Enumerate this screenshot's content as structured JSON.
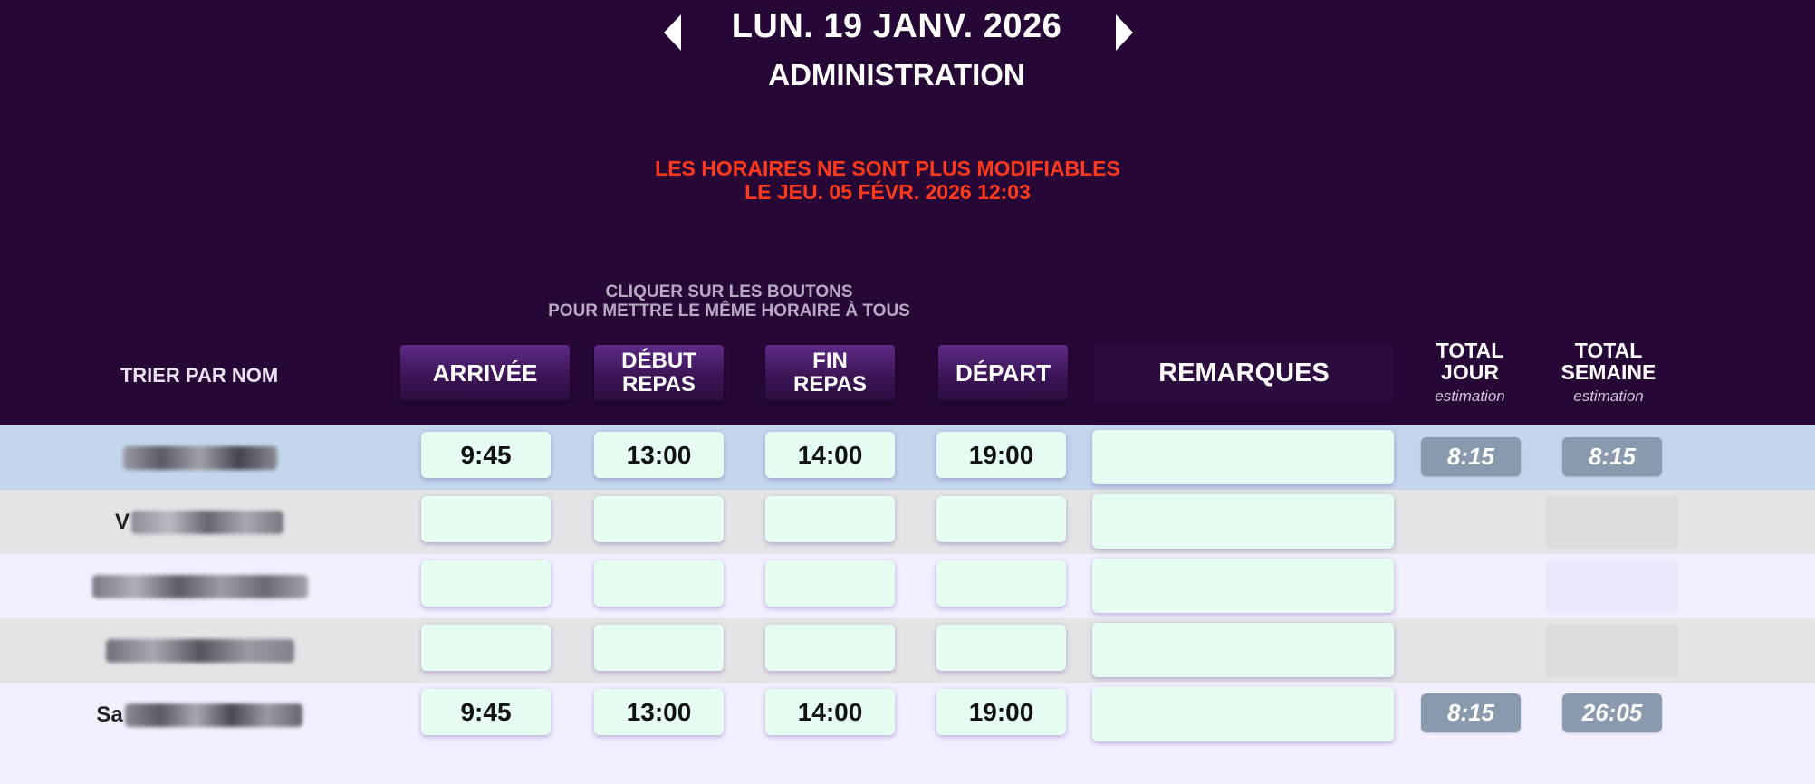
{
  "header": {
    "date": "LUN. 19 JANV. 2026",
    "department": "ADMINISTRATION",
    "lock_notice_line1": "LES HORAIRES NE SONT PLUS MODIFIABLES",
    "lock_notice_line2": "LE JEU. 05 FÉVR. 2026 12:03",
    "prev_icon": "caret-left-icon",
    "next_icon": "caret-right-icon"
  },
  "hint": {
    "line1": "CLIQUER SUR LES BOUTONS",
    "line2": "POUR METTRE LE  MÊME HORAIRE À TOUS"
  },
  "columns": {
    "sort_by_name": "TRIER PAR NOM",
    "arrival": "ARRIVÉE",
    "lunch_start_line1": "DÉBUT",
    "lunch_start_line2": "REPAS",
    "lunch_end_line1": "FIN",
    "lunch_end_line2": "REPAS",
    "departure": "DÉPART",
    "remarks": "REMARQUES",
    "total_day_line1": "TOTAL",
    "total_day_line2": "JOUR",
    "total_week_line1": "TOTAL",
    "total_week_line2": "SEMAINE",
    "estimate_label": "estimation"
  },
  "rows": [
    {
      "name_visible": "",
      "arrival": "9:45",
      "lunch_start": "13:00",
      "lunch_end": "14:00",
      "departure": "19:00",
      "remarks": "",
      "total_day": "8:15",
      "total_week": "8:15"
    },
    {
      "name_visible": "V",
      "arrival": "",
      "lunch_start": "",
      "lunch_end": "",
      "departure": "",
      "remarks": "",
      "total_day": "",
      "total_week": ""
    },
    {
      "name_visible": "",
      "arrival": "",
      "lunch_start": "",
      "lunch_end": "",
      "departure": "",
      "remarks": "",
      "total_day": "",
      "total_week": ""
    },
    {
      "name_visible": "",
      "arrival": "",
      "lunch_start": "",
      "lunch_end": "",
      "departure": "",
      "remarks": "",
      "total_day": "",
      "total_week": ""
    },
    {
      "name_visible": "Sa",
      "arrival": "9:45",
      "lunch_start": "13:00",
      "lunch_end": "14:00",
      "departure": "19:00",
      "remarks": "",
      "total_day": "8:15",
      "total_week": "26:05"
    }
  ],
  "colors": {
    "header_bg": "#260735",
    "warning": "#ff3a1c",
    "selected_row": "#c4d6ec",
    "alt_row": "#e4e4e6",
    "row": "#f2efff",
    "time_field": "#e6fdf2",
    "total_pill": "#8a9aae"
  }
}
